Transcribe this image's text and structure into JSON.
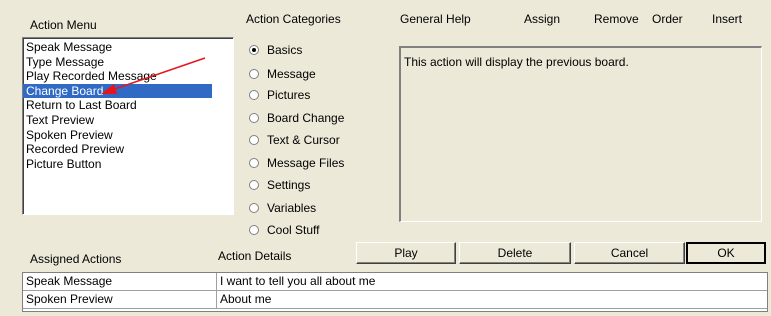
{
  "headers": {
    "action_menu": "Action Menu",
    "action_categories": "Action Categories",
    "general_help": "General Help",
    "assign": "Assign",
    "remove": "Remove",
    "order": "Order",
    "insert": "Insert",
    "assigned_actions": "Assigned Actions",
    "action_details": "Action Details"
  },
  "action_menu": {
    "items": [
      {
        "label": "Speak Message"
      },
      {
        "label": "Type Message"
      },
      {
        "label": "Play Recorded Message"
      },
      {
        "label": "Change Board",
        "selected": true
      },
      {
        "label": "Return to Last Board"
      },
      {
        "label": "Text Preview"
      },
      {
        "label": "Spoken Preview"
      },
      {
        "label": "Recorded Preview"
      },
      {
        "label": "Picture Button"
      }
    ]
  },
  "categories": [
    {
      "label": "Basics",
      "checked": true
    },
    {
      "label": "Message"
    },
    {
      "label": "Pictures"
    },
    {
      "label": "Board Change"
    },
    {
      "label": "Text & Cursor"
    },
    {
      "label": "Message Files"
    },
    {
      "label": "Settings"
    },
    {
      "label": "Variables"
    },
    {
      "label": "Cool Stuff"
    }
  ],
  "help_text": "This action will display the previous board.",
  "buttons": {
    "play": "Play",
    "delete": "Delete",
    "cancel": "Cancel",
    "ok": "OK"
  },
  "assigned": [
    {
      "action": "Speak Message",
      "details": "I want to tell you all about me"
    },
    {
      "action": "Spoken Preview",
      "details": "About me"
    }
  ],
  "colors": {
    "selection": "#316ac5",
    "annotation_arrow": "#e8141c",
    "dialog_bg": "#ece9d8"
  }
}
